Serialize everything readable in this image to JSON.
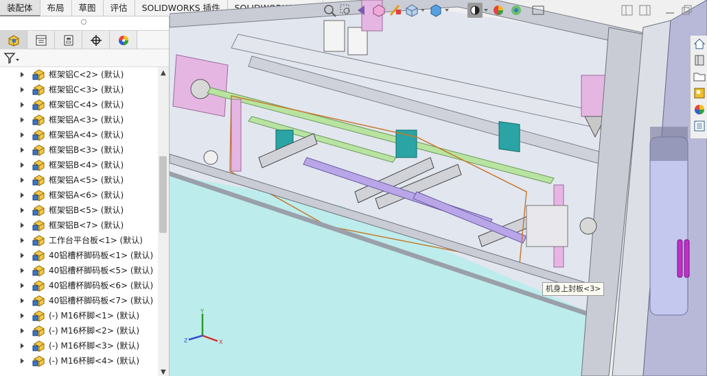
{
  "command_tabs": [
    {
      "label": "装配体",
      "active": true
    },
    {
      "label": "布局",
      "active": false
    },
    {
      "label": "草图",
      "active": false
    },
    {
      "label": "评估",
      "active": false
    },
    {
      "label": "SOLIDWORKS 插件",
      "active": false
    },
    {
      "label": "SOLIDWORKS MBD",
      "active": false
    }
  ],
  "feature_manager": {
    "panel_tabs": [
      {
        "icon": "feature-manager-icon",
        "active": true
      },
      {
        "icon": "property-manager-icon",
        "active": false
      },
      {
        "icon": "configuration-manager-icon",
        "active": false
      },
      {
        "icon": "dimxpert-manager-icon",
        "active": false
      },
      {
        "icon": "display-manager-icon",
        "active": false
      }
    ],
    "filter_icon": "filter-icon",
    "tree_items": [
      {
        "label": "框架铝C<2> (默认)"
      },
      {
        "label": "框架铝C<3> (默认)"
      },
      {
        "label": "框架铝C<4> (默认)"
      },
      {
        "label": "框架铝A<3> (默认)"
      },
      {
        "label": "框架铝A<4> (默认)"
      },
      {
        "label": "框架铝B<3> (默认)"
      },
      {
        "label": "框架铝B<4> (默认)"
      },
      {
        "label": "框架铝A<5> (默认)"
      },
      {
        "label": "框架铝A<6> (默认)"
      },
      {
        "label": "框架铝B<5> (默认)"
      },
      {
        "label": "框架铝B<7> (默认)"
      },
      {
        "label": "工作台平台板<1> (默认)"
      },
      {
        "label": "40铝槽杯脚码板<1> (默认)"
      },
      {
        "label": "40铝槽杯脚码板<5> (默认)"
      },
      {
        "label": "40铝槽杯脚码板<6> (默认)"
      },
      {
        "label": "40铝槽杯脚码板<7> (默认)"
      },
      {
        "label": "(-) M16杯脚<1> (默认)"
      },
      {
        "label": "(-) M16杯脚<2> (默认)"
      },
      {
        "label": "(-) M16杯脚<3> (默认)"
      },
      {
        "label": "(-) M16杯脚<4> (默认)"
      }
    ]
  },
  "viewport": {
    "tooltip": "机身上封板<3>",
    "triad_axes": [
      "X",
      "Y",
      "Z"
    ]
  },
  "colors": {
    "floor": "#bdecec",
    "frame": "#c9ccd4",
    "pink_part": "#e6b6e3",
    "teal_part": "#2aa4a4",
    "selection_edge": "#c9782b",
    "belt": "#b8e3a0"
  }
}
